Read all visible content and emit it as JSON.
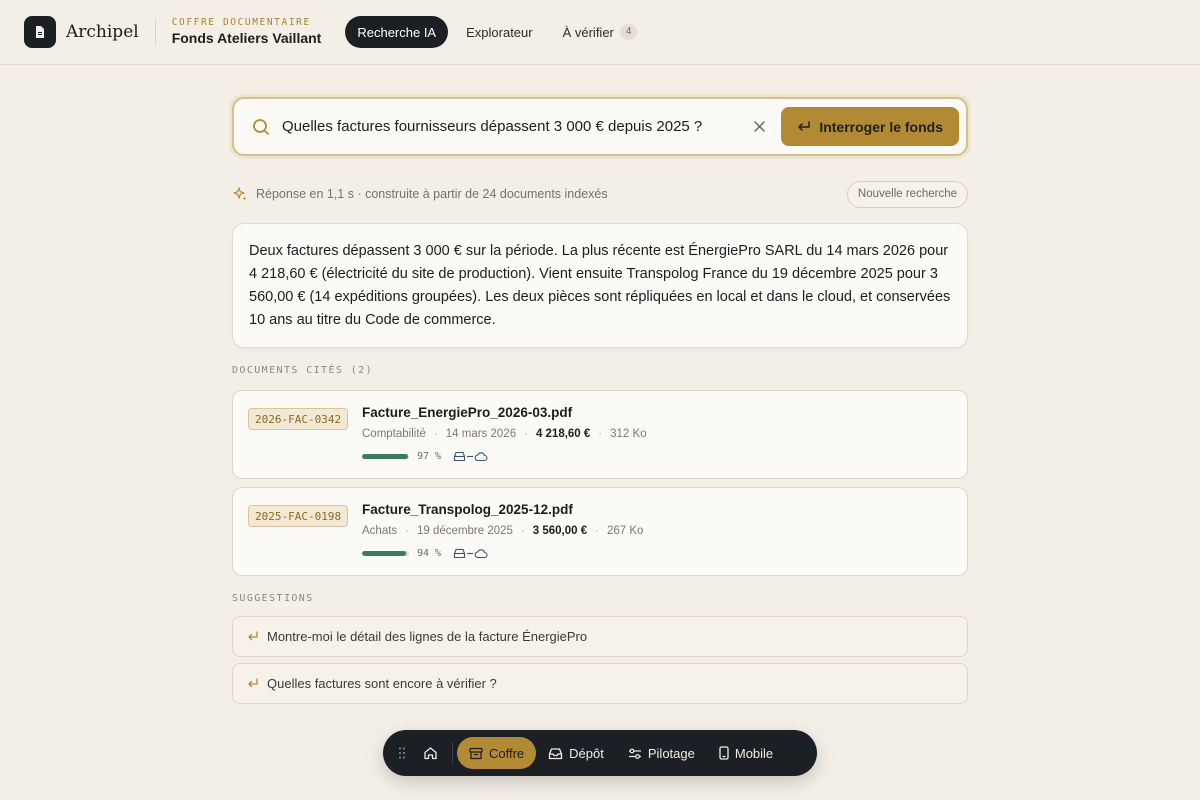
{
  "header": {
    "app_name": "Archipel",
    "vault_kicker": "COFFRE DOCUMENTAIRE",
    "vault_name": "Fonds Ateliers Vaillant",
    "nav": [
      {
        "label": "Recherche IA",
        "active": true
      },
      {
        "label": "Explorateur",
        "active": false
      },
      {
        "label": "À vérifier",
        "badge": "4",
        "active": false
      }
    ]
  },
  "search": {
    "value": "Quelles factures fournisseurs dépassent 3 000 € depuis 2025 ?",
    "button_label": "Interroger le fonds"
  },
  "meta": {
    "text": "Réponse en 1,1 s · construite à partir de 24 documents indexés",
    "new_search_label": "Nouvelle recherche"
  },
  "answer": {
    "text": "Deux factures dépassent 3 000 € sur la période. La plus récente est ÉnergiePro SARL du 14 mars 2026 pour 4 218,60 € (électricité du site de production). Vient ensuite Transpolog France du 19 décembre 2025 pour 3 560,00 € (14 expéditions groupées). Les deux pièces sont répliquées en local et dans le cloud, et conservées 10 ans au titre du Code de commerce."
  },
  "cited": {
    "label": "DOCUMENTS CITÉS (2)",
    "docs": [
      {
        "ref": "2026-FAC-0342",
        "name": "Facture_EnergiePro_2026-03.pdf",
        "category": "Comptabilité",
        "date": "14 mars 2026",
        "amount": "4 218,60 €",
        "size": "312 Ko",
        "score": 0.97,
        "score_label": "97 %"
      },
      {
        "ref": "2025-FAC-0198",
        "name": "Facture_Transpolog_2025-12.pdf",
        "category": "Achats",
        "date": "19 décembre 2025",
        "amount": "3 560,00 €",
        "size": "267 Ko",
        "score": 0.94,
        "score_label": "94 %"
      }
    ]
  },
  "suggestions": {
    "label": "SUGGESTIONS",
    "items": [
      "Montre-moi le détail des lignes de la facture ÉnergiePro",
      "Quelles factures sont encore à vérifier ?"
    ]
  },
  "dock": {
    "items": [
      {
        "label": "Coffre",
        "icon": "archive-icon",
        "active": true
      },
      {
        "label": "Dépôt",
        "icon": "inbox-icon",
        "active": false
      },
      {
        "label": "Pilotage",
        "icon": "sliders-icon",
        "active": false
      },
      {
        "label": "Mobile",
        "icon": "phone-icon",
        "active": false
      }
    ]
  },
  "colors": {
    "accent": "#b38a34",
    "dark": "#1c1f24",
    "background": "#f3efe7",
    "success": "#3a7d5c"
  }
}
